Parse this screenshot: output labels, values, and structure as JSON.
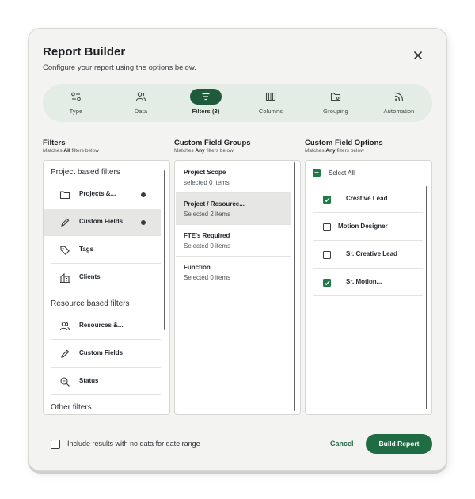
{
  "header": {
    "title": "Report Builder",
    "subtitle": "Configure your report using the options below."
  },
  "steps": [
    {
      "label": "Type",
      "icon": "type-sliders-icon",
      "active": false
    },
    {
      "label": "Data",
      "icon": "data-users-icon",
      "active": false
    },
    {
      "label": "Filters (3)",
      "icon": "filter-lines-icon",
      "active": true
    },
    {
      "label": "Columns",
      "icon": "columns-icon",
      "active": false
    },
    {
      "label": "Grouping",
      "icon": "grouping-folder-icon",
      "active": false
    },
    {
      "label": "Automation",
      "icon": "automation-rss-icon",
      "active": false
    }
  ],
  "filters": {
    "heading": "Filters",
    "sub_prefix": "Matches ",
    "sub_bold": "All",
    "sub_suffix": " filters below",
    "groups": [
      {
        "title": "Project based filters",
        "items": [
          {
            "label": "Projects &...",
            "icon": "folder-icon",
            "has_dot": true,
            "selected": false
          },
          {
            "label": "Custom Fields",
            "icon": "pencil-icon",
            "has_dot": true,
            "selected": true
          },
          {
            "label": "Tags",
            "icon": "tag-icon",
            "has_dot": false,
            "selected": false
          },
          {
            "label": "Clients",
            "icon": "building-icon",
            "has_dot": false,
            "selected": false
          }
        ]
      },
      {
        "title": "Resource based filters",
        "items": [
          {
            "label": "Resources &...",
            "icon": "users-icon",
            "has_dot": false,
            "selected": false
          },
          {
            "label": "Custom Fields",
            "icon": "pencil-icon",
            "has_dot": false,
            "selected": false
          },
          {
            "label": "Status",
            "icon": "status-search-icon",
            "has_dot": false,
            "selected": false
          }
        ]
      },
      {
        "title": "Other filters",
        "items": []
      }
    ]
  },
  "field_groups": {
    "heading": "Custom Field Groups",
    "sub_prefix": "Matches ",
    "sub_bold": "Any",
    "sub_suffix": " filters below",
    "items": [
      {
        "name": "Project Scope",
        "sub": "selected 0 items",
        "selected": false
      },
      {
        "name": "Project / Resource...",
        "sub": "Selected 2 items",
        "selected": true
      },
      {
        "name": "FTE's Required",
        "sub": "Selected 0 items",
        "selected": false
      },
      {
        "name": "Function",
        "sub": "Selected 0 items",
        "selected": false
      }
    ]
  },
  "field_options": {
    "heading": "Custom Field Options",
    "sub_prefix": "Matches ",
    "sub_bold": "Any",
    "sub_suffix": " filters below",
    "select_all_label": "Select All",
    "select_all_state": "indeterminate",
    "options": [
      {
        "label": "Creative Lead",
        "checked": true
      },
      {
        "label": "Motion Designer",
        "checked": false
      },
      {
        "label": "Sr. Creative Lead",
        "checked": false
      },
      {
        "label": "Sr. Motion...",
        "checked": true
      }
    ]
  },
  "footer": {
    "include_label": "Include results with no data for date range",
    "include_checked": false,
    "cancel_label": "Cancel",
    "build_label": "Build Report"
  },
  "colors": {
    "accent": "#1f6b43",
    "active_step": "#1f5a3c",
    "step_bar": "#e3ece5",
    "selected_row": "#e6e6e4",
    "modal_bg": "#f3f3f1"
  }
}
